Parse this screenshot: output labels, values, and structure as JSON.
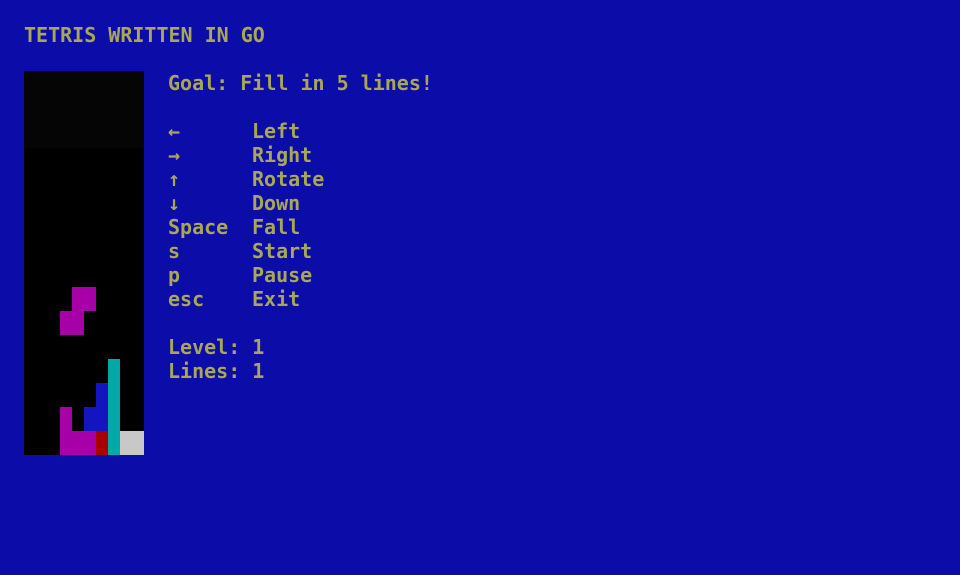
{
  "title": "TETRIS WRITTEN IN GO",
  "goal": "Goal: Fill in 5 lines!",
  "controls": [
    {
      "key": "←",
      "action": "Left"
    },
    {
      "key": "→",
      "action": "Right"
    },
    {
      "key": "↑",
      "action": "Rotate"
    },
    {
      "key": "↓",
      "action": "Down"
    },
    {
      "key": "Space",
      "action": "Fall"
    },
    {
      "key": "s",
      "action": "Start"
    },
    {
      "key": "p",
      "action": "Pause"
    },
    {
      "key": "esc",
      "action": "Exit"
    }
  ],
  "status": {
    "level": "Level: 1",
    "lines": "Lines: 1"
  },
  "colors": {
    "background": "#0c0ca8",
    "text": "#a8a854",
    "board": "#000000",
    "magenta": "#a800a8",
    "blue": "#1414c0",
    "cyan": "#00a8a8",
    "red": "#a80000",
    "grey": "#c8c8c8"
  },
  "board": {
    "columns": 10,
    "rows": 16,
    "blocks": [
      {
        "col": 4,
        "row": 9,
        "color": "magenta",
        "piece": "falling"
      },
      {
        "col": 5,
        "row": 9,
        "color": "magenta",
        "piece": "falling"
      },
      {
        "col": 3,
        "row": 10,
        "color": "magenta",
        "piece": "falling"
      },
      {
        "col": 4,
        "row": 10,
        "color": "magenta",
        "piece": "falling"
      },
      {
        "col": 7,
        "row": 12,
        "color": "cyan",
        "piece": "stack"
      },
      {
        "col": 7,
        "row": 13,
        "color": "cyan",
        "piece": "stack"
      },
      {
        "col": 7,
        "row": 14,
        "color": "cyan",
        "piece": "stack"
      },
      {
        "col": 7,
        "row": 15,
        "color": "cyan",
        "piece": "stack"
      },
      {
        "col": 6,
        "row": 13,
        "color": "blue",
        "piece": "stack"
      },
      {
        "col": 5,
        "row": 14,
        "color": "blue",
        "piece": "stack"
      },
      {
        "col": 6,
        "row": 14,
        "color": "blue",
        "piece": "stack"
      },
      {
        "col": 3,
        "row": 14,
        "color": "magenta",
        "piece": "stack"
      },
      {
        "col": 3,
        "row": 15,
        "color": "magenta",
        "piece": "stack"
      },
      {
        "col": 4,
        "row": 15,
        "color": "magenta",
        "piece": "stack"
      },
      {
        "col": 5,
        "row": 15,
        "color": "magenta",
        "piece": "stack"
      },
      {
        "col": 6,
        "row": 15,
        "color": "red",
        "piece": "stack"
      },
      {
        "col": 8,
        "row": 15,
        "color": "grey",
        "piece": "stack"
      },
      {
        "col": 9,
        "row": 15,
        "color": "grey",
        "piece": "stack"
      }
    ]
  }
}
